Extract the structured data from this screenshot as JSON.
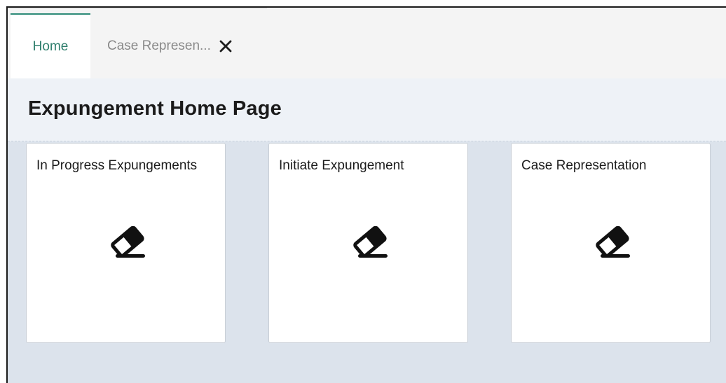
{
  "tabs": [
    {
      "label": "Home",
      "active": true
    },
    {
      "label": "Case Represen...",
      "active": false,
      "closable": true
    }
  ],
  "page": {
    "title": "Expungement Home Page"
  },
  "cards": [
    {
      "title": "In Progress Expungements",
      "icon": "eraser-icon"
    },
    {
      "title": "Initiate Expungement",
      "icon": "eraser-icon"
    },
    {
      "title": "Case Representation",
      "icon": "eraser-icon"
    }
  ],
  "colors": {
    "accent": "#2e8b78",
    "page_background": "#dce3ec",
    "header_background": "#eef2f7"
  }
}
